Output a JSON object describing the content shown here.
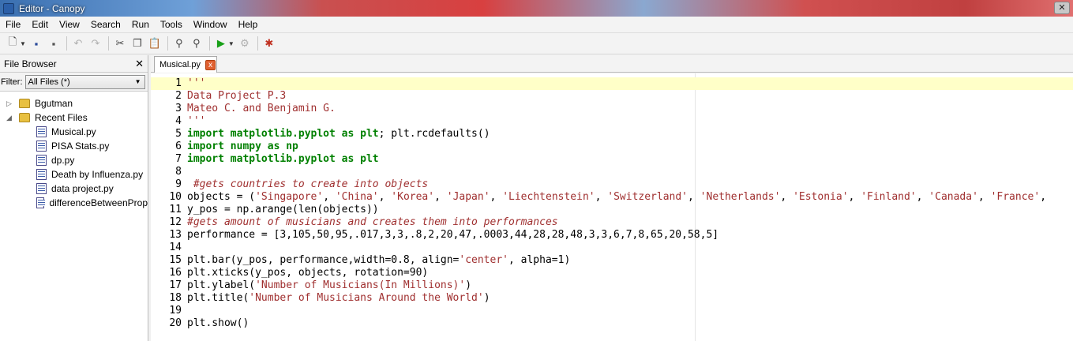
{
  "window": {
    "title": "Editor - Canopy",
    "close_label": "✕"
  },
  "menu": [
    "File",
    "Edit",
    "View",
    "Search",
    "Run",
    "Tools",
    "Window",
    "Help"
  ],
  "file_browser": {
    "title": "File Browser",
    "close_label": "✕",
    "filter_label": "Filter:",
    "filter_value": "All Files (*)",
    "folders": [
      {
        "name": "Bgutman",
        "expanded": false
      },
      {
        "name": "Recent Files",
        "expanded": true
      }
    ],
    "recent_files": [
      "Musical.py",
      "PISA Stats.py",
      "dp.py",
      "Death by Influenza.py",
      "data project.py",
      "differenceBetweenProp"
    ]
  },
  "editor": {
    "tab_label": "Musical.py",
    "tab_close_label": "x",
    "current_line": 1,
    "line_numbers": [
      "1",
      "2",
      "3",
      "4",
      "5",
      "6",
      "7",
      "8",
      "9",
      "10",
      "11",
      "12",
      "13",
      "14",
      "15",
      "16",
      "17",
      "18",
      "19",
      "20"
    ]
  }
}
